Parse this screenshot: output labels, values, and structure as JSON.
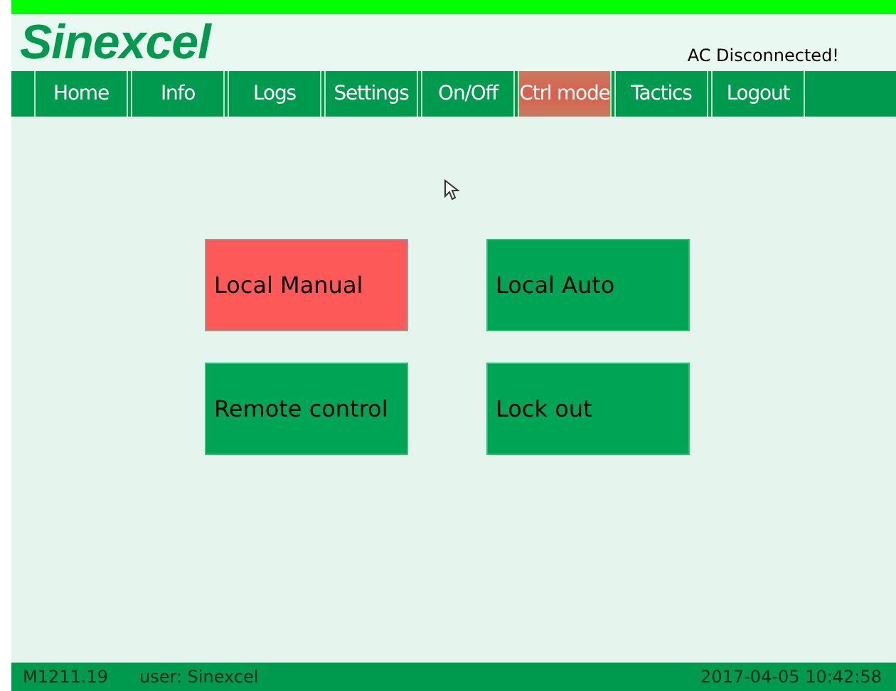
{
  "logo": "Sinexcel",
  "alert": "AC Disconnected!",
  "tabs": [
    {
      "label": "Home",
      "selected": false
    },
    {
      "label": "Info",
      "selected": false
    },
    {
      "label": "Logs",
      "selected": false
    },
    {
      "label": "Settings",
      "selected": false
    },
    {
      "label": "On/Off",
      "selected": false
    },
    {
      "label": "Ctrl mode",
      "selected": true
    },
    {
      "label": "Tactics",
      "selected": false
    },
    {
      "label": "Logout",
      "selected": false
    }
  ],
  "modes": [
    {
      "label": "Local Manual",
      "selected": true
    },
    {
      "label": "Local Auto",
      "selected": false
    },
    {
      "label": "Remote control",
      "selected": false
    },
    {
      "label": "Lock out",
      "selected": false
    }
  ],
  "status_bar": {
    "version": "M1211.19",
    "user": "user: Sinexcel",
    "datetime": "2017-04-05 10:42:58"
  }
}
